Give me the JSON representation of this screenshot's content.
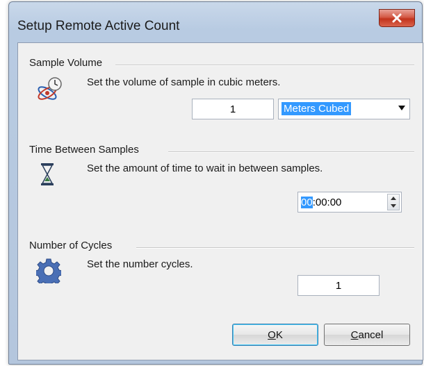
{
  "window": {
    "title": "Setup Remote Active Count",
    "close_icon": "close-x-icon"
  },
  "sample_volume": {
    "header": "Sample Volume",
    "description": "Set the volume of sample in cubic meters.",
    "value": "1",
    "unit_selected": "Meters Cubed",
    "icon": "atom-clock-icon"
  },
  "time_between": {
    "header": "Time Between Samples",
    "description": "Set the amount of time to wait in between samples.",
    "hours_selected": "00",
    "rest": ":00:00",
    "icon": "hourglass-icon"
  },
  "cycles": {
    "header": "Number of Cycles",
    "description": "Set the number cycles.",
    "value": "1",
    "icon": "gear-icon"
  },
  "buttons": {
    "ok_mnemonic": "O",
    "ok_rest": "K",
    "cancel_mnemonic": "C",
    "cancel_rest": "ancel"
  },
  "colors": {
    "selection": "#3399ff",
    "close_red": "#c2341d",
    "frame_blue": "#b8cbe2"
  }
}
